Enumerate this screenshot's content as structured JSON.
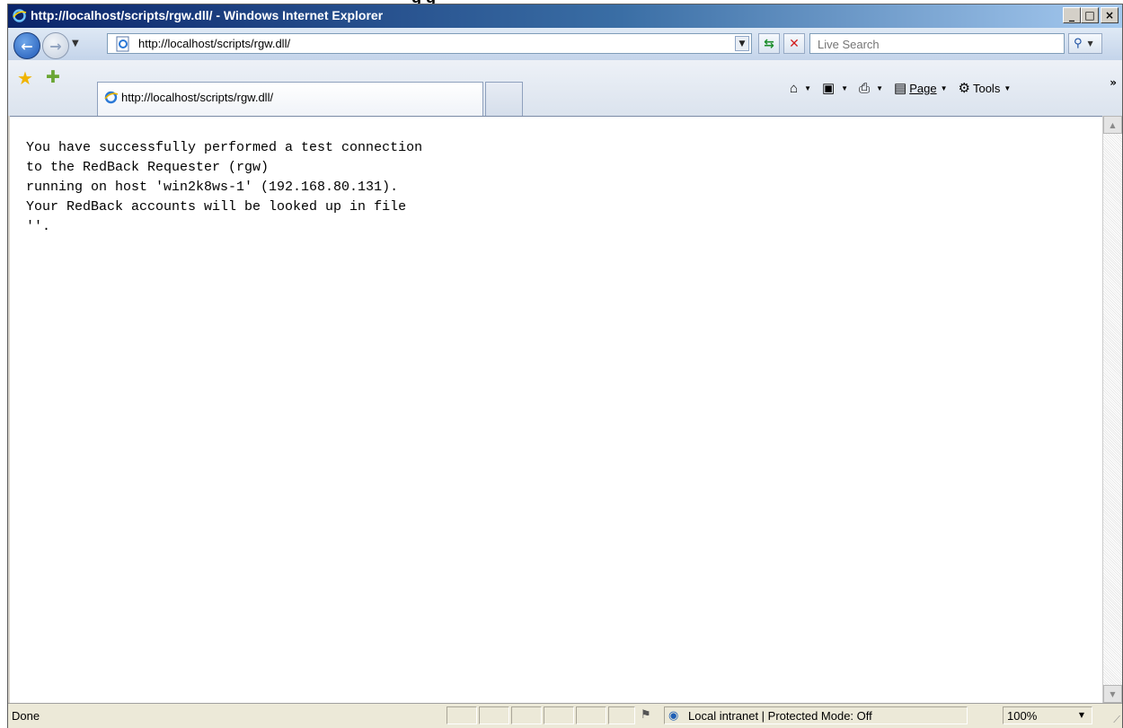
{
  "window": {
    "title": "http://localhost/scripts/rgw.dll/ - Windows Internet Explorer",
    "minimize": "_",
    "maximize": "□",
    "close": "×"
  },
  "navbar": {
    "address": "http://localhost/scripts/rgw.dll/",
    "search_placeholder": "Live Search",
    "back_glyph": "←",
    "forward_glyph": "→",
    "refresh_glyph": "⇆",
    "stop_glyph": "✕",
    "search_glyph": "⚲"
  },
  "command_bar": {
    "tab_title": "http://localhost/scripts/rgw.dll/",
    "page_label": "Page",
    "tools_label": "Tools",
    "more": "»"
  },
  "content": {
    "lines": [
      "You have successfully performed a test connection",
      "to the RedBack Requester (rgw)",
      "running on host 'win2k8ws-1' (192.168.80.131).",
      "Your RedBack accounts will be looked up in file",
      "''."
    ]
  },
  "status_bar": {
    "status": "Done",
    "zone": "Local intranet | Protected Mode: Off",
    "zoom": "100%"
  },
  "colors": {
    "titlebar_start": "#0a246a",
    "titlebar_end": "#a6caf0",
    "chrome": "#d8d4cb"
  }
}
